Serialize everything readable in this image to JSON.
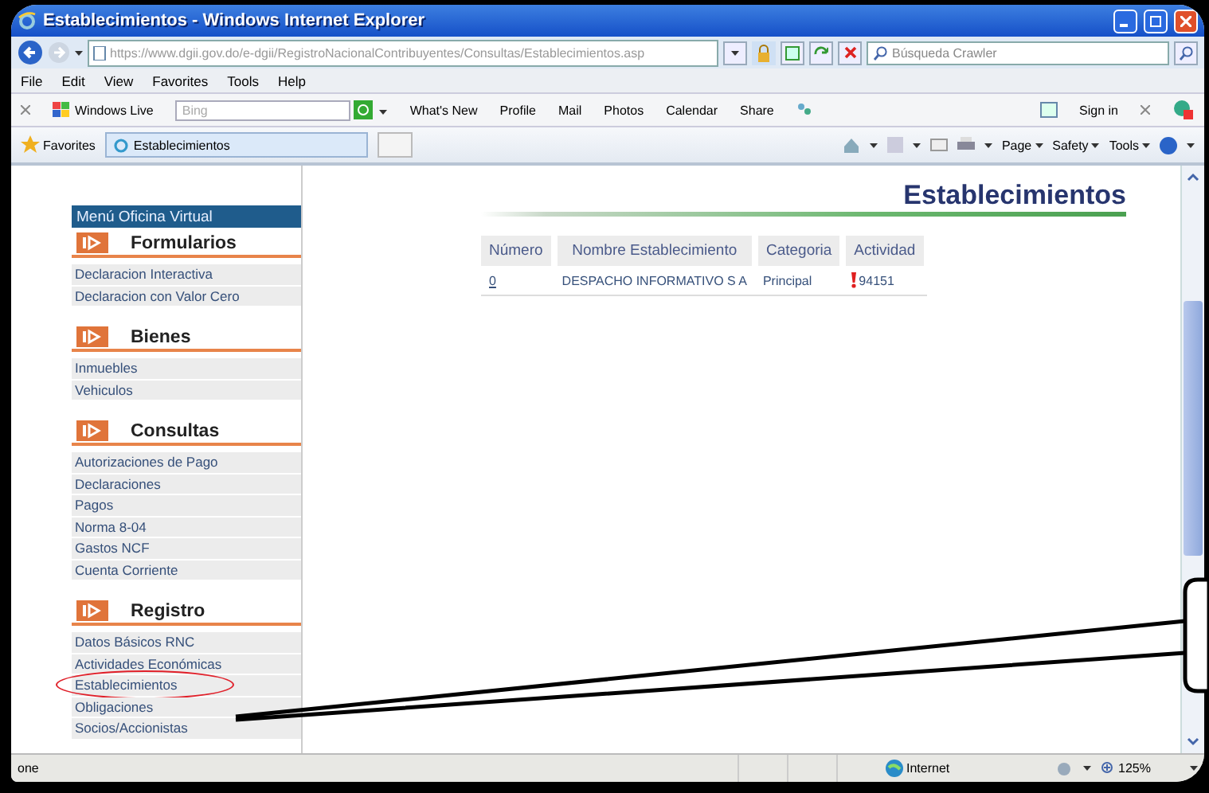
{
  "window": {
    "title": "Establecimientos - Windows Internet Explorer"
  },
  "address_bar": {
    "url": "https://www.dgii.gov.do/e-dgii/RegistroNacionalContribuyentes/Consultas/Establecimientos.asp",
    "search_placeholder": "Búsqueda Crawler"
  },
  "menu": [
    "File",
    "Edit",
    "View",
    "Favorites",
    "Tools",
    "Help"
  ],
  "live_toolbar": {
    "brand": "Windows Live",
    "search_placeholder": "Bing",
    "links": [
      "What's New",
      "Profile",
      "Mail",
      "Photos",
      "Calendar",
      "Share"
    ],
    "sign_in": "Sign in"
  },
  "favorites_bar": {
    "label": "Favorites",
    "tab": "Establecimientos",
    "commands": [
      "Page",
      "Safety",
      "Tools"
    ]
  },
  "sidebar": {
    "title": "Menú Oficina Virtual",
    "sections": [
      {
        "heading": "Formularios",
        "items": [
          {
            "label": "Declaracion Interactiva",
            "circled": false
          },
          {
            "label": "Declaracion con Valor Cero",
            "circled": false
          }
        ]
      },
      {
        "heading": "Bienes",
        "items": [
          {
            "label": "Inmuebles",
            "circled": false
          },
          {
            "label": "Vehiculos",
            "circled": false
          }
        ]
      },
      {
        "heading": "Consultas",
        "items": [
          {
            "label": "Autorizaciones de Pago",
            "circled": false
          },
          {
            "label": "Declaraciones",
            "circled": false
          },
          {
            "label": "Pagos",
            "circled": false
          },
          {
            "label": "Norma 8-04",
            "circled": false
          },
          {
            "label": "Gastos NCF",
            "circled": false
          },
          {
            "label": "Cuenta Corriente",
            "circled": false
          }
        ]
      },
      {
        "heading": "Registro",
        "items": [
          {
            "label": "Datos Básicos RNC",
            "circled": false
          },
          {
            "label": "Actividades Económicas",
            "circled": false
          },
          {
            "label": "Establecimientos",
            "circled": true
          },
          {
            "label": "Obligaciones",
            "circled": false
          },
          {
            "label": "Socios/Accionistas",
            "circled": false
          }
        ]
      }
    ]
  },
  "page": {
    "heading": "Establecimientos",
    "table": {
      "columns": [
        "Número",
        "Nombre Establecimiento",
        "Categoria",
        "Actividad"
      ],
      "rows": [
        {
          "numero": "0",
          "nombre": "DESPACHO INFORMATIVO S A",
          "categoria": "Principal",
          "actividad": "94151"
        }
      ]
    }
  },
  "status_bar": {
    "text": "one",
    "zone": "Internet",
    "zoom": "125%"
  }
}
